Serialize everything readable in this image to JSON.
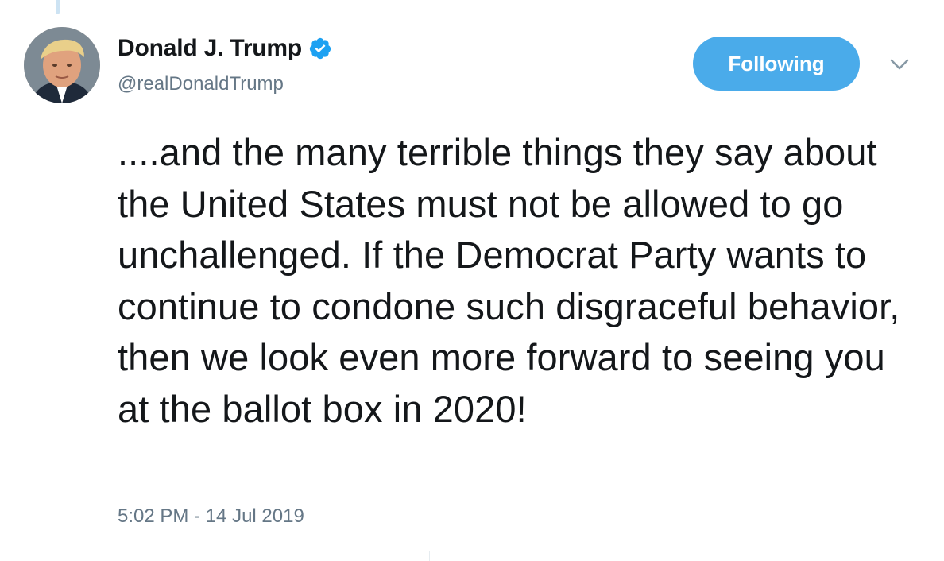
{
  "tweet": {
    "author": {
      "display_name": "Donald J. Trump",
      "handle": "@realDonaldTrump",
      "verified": true,
      "avatar_icon": "profile-photo"
    },
    "follow_button_label": "Following",
    "menu_icon": "chevron-down-icon",
    "text": "....and the many terrible things they say about the United States must not be allowed to go unchallenged. If the Democrat Party wants to continue to condone such disgraceful behavior, then we look even more forward to seeing you at the ballot box in 2020!",
    "timestamp": "5:02 PM - 14 Jul 2019"
  },
  "colors": {
    "accent": "#4aabea",
    "verified_badge": "#1da1f2",
    "text_primary": "#14171a",
    "text_secondary": "#657786",
    "divider": "#e6ecf0",
    "thread_line": "#cde3f3"
  }
}
